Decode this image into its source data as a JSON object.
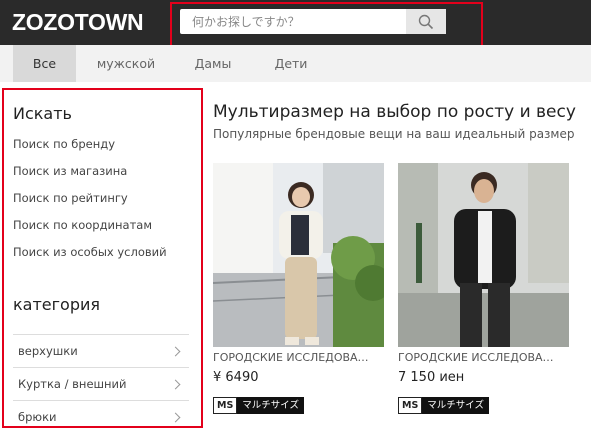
{
  "header": {
    "logo": "ZOZOTOWN",
    "search_placeholder": "何かお探しですか？"
  },
  "tabs": [
    {
      "label": "Все",
      "active": true
    },
    {
      "label": "мужской",
      "active": false
    },
    {
      "label": "Дамы",
      "active": false
    },
    {
      "label": "Дети",
      "active": false
    }
  ],
  "sidebar": {
    "search_title": "Искать",
    "search_links": [
      "Поиск по бренду",
      "Поиск из магазина",
      "Поиск по рейтингу",
      "Поиск по координатам",
      "Поиск из особых условий"
    ],
    "category_title": "категория",
    "categories": [
      "верхушки",
      "Куртка / внешний",
      "брюки"
    ]
  },
  "main": {
    "title": "Мультиразмер на выбор по росту и весу",
    "subtitle": "Популярные брендовые вещи на ваш идеальный размер",
    "products": [
      {
        "brand": "ГОРОДСКИЕ ИССЛЕДОВА…",
        "price": "¥ 6490",
        "badge_tag": "MS",
        "badge_text": "マルチサイズ"
      },
      {
        "brand": "ГОРОДСКИЕ ИССЛЕДОВА…",
        "price": "7 150 иен",
        "badge_tag": "MS",
        "badge_text": "マルチサイズ"
      }
    ]
  },
  "colors": {
    "header_bg": "#2a2a2a",
    "highlight": "#e3001b",
    "tab_bar_bg": "#f2f2f2",
    "tab_active_bg": "#d9d9d9"
  }
}
